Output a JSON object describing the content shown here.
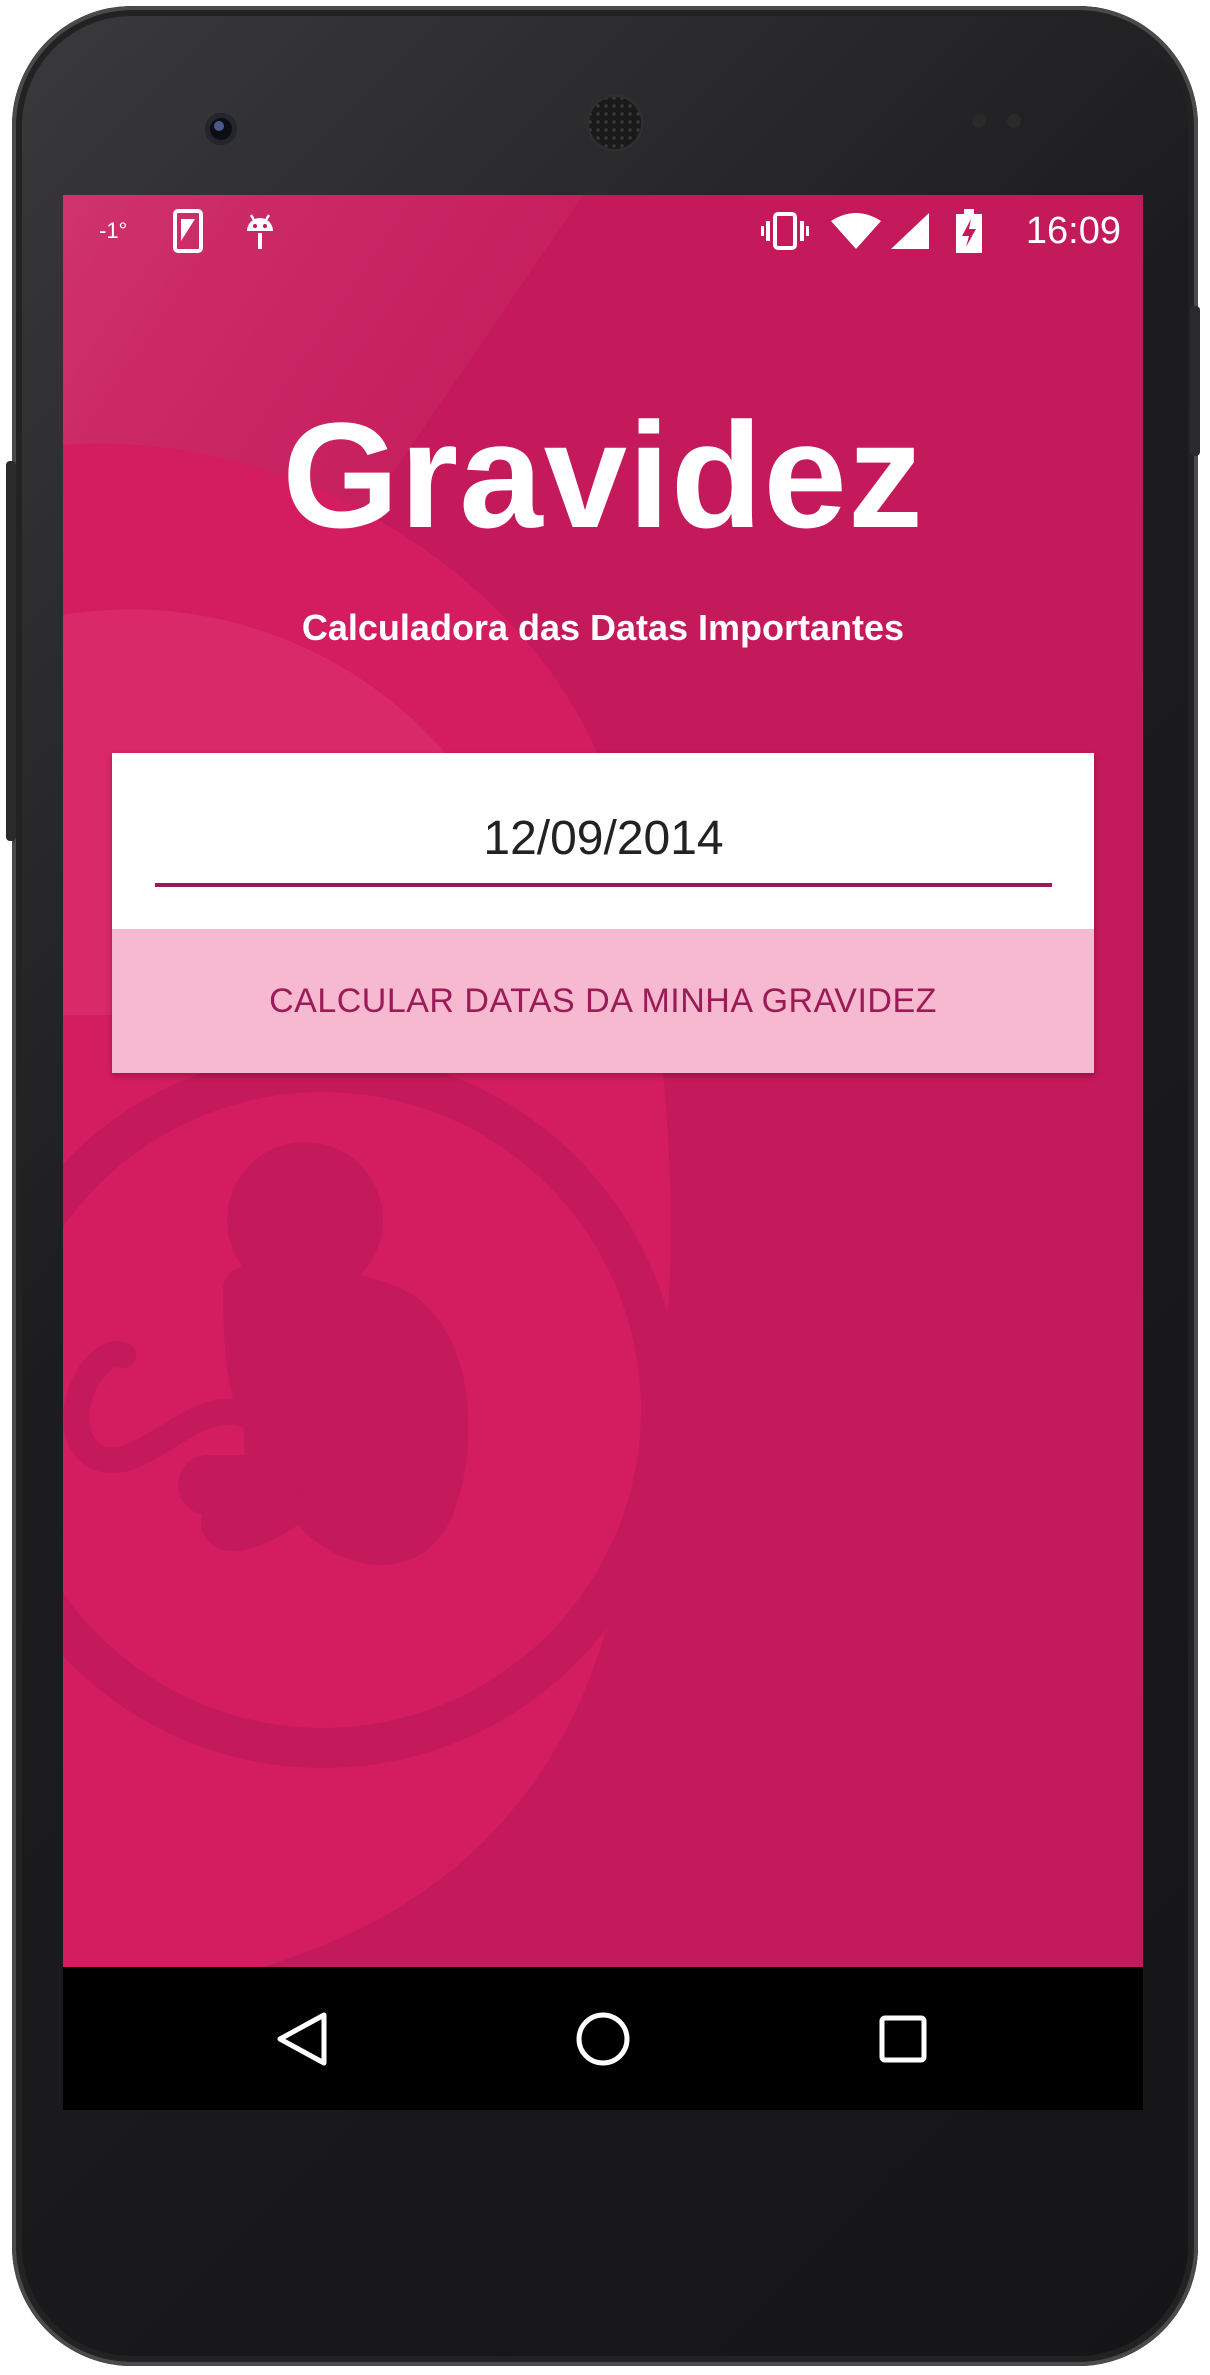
{
  "status_bar": {
    "temperature": "-1°",
    "time": "16:09",
    "icons": [
      "phone-screen-icon",
      "android-debug-icon",
      "vibrate-icon",
      "wifi-icon",
      "cell-signal-icon",
      "battery-charging-icon"
    ]
  },
  "app": {
    "title": "Gravidez",
    "subtitle": "Calculadora das Datas Importantes"
  },
  "form": {
    "date_value": "12/09/2014",
    "calculate_label": "CALCULAR DATAS DA MINHA GRAVIDEZ"
  },
  "nav_bar": {
    "icons": [
      "back-icon",
      "home-icon",
      "recents-icon"
    ]
  },
  "colors": {
    "primary": "#c4195a",
    "button_bg": "#f6b9d0",
    "button_text": "#9c1b57"
  }
}
